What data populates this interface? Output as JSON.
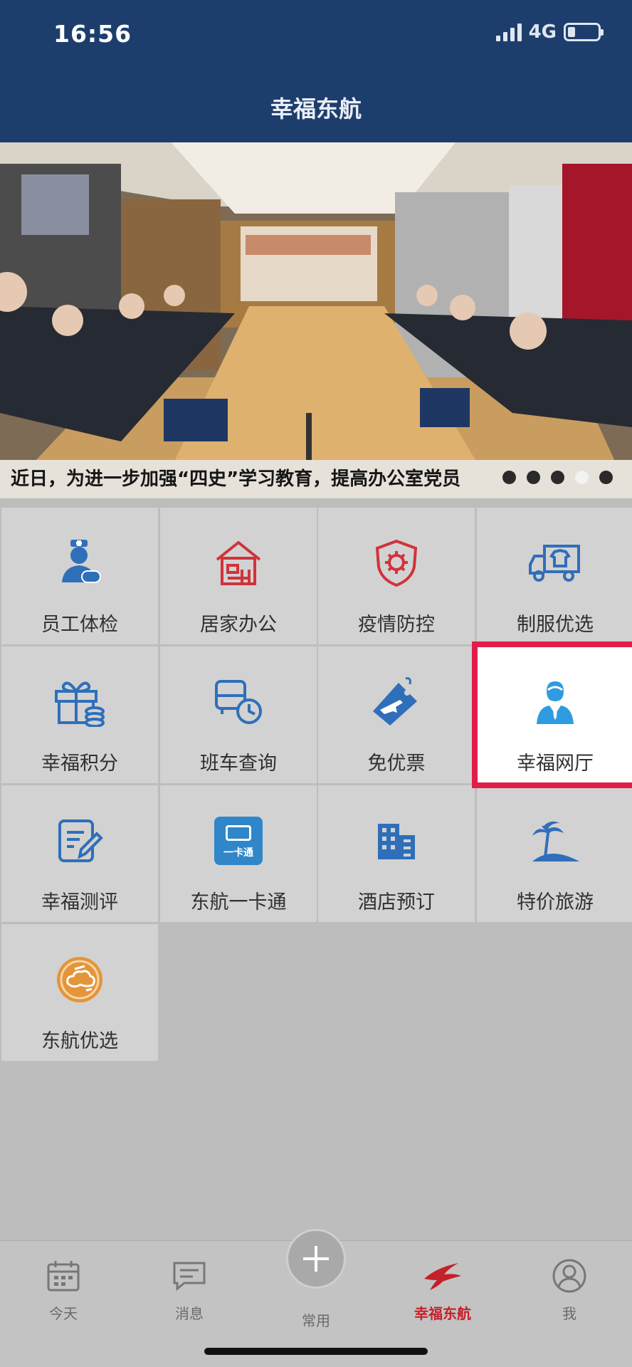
{
  "status_bar": {
    "time": "16:56",
    "network": "4G"
  },
  "header": {
    "title": "幸福东航"
  },
  "banner": {
    "caption": "近日，为进一步加强“四史”学习教育，提高办公室党员",
    "dot_count": 5,
    "active_dot": 3
  },
  "grid": [
    {
      "label": "员工体检",
      "icon": "doctor-icon"
    },
    {
      "label": "居家办公",
      "icon": "home-office-icon"
    },
    {
      "label": "疫情防控",
      "icon": "virus-shield-icon"
    },
    {
      "label": "制服优选",
      "icon": "uniform-truck-icon"
    },
    {
      "label": "幸福积分",
      "icon": "gift-coins-icon"
    },
    {
      "label": "班车查询",
      "icon": "bus-clock-icon"
    },
    {
      "label": "免优票",
      "icon": "ticket-plane-icon"
    },
    {
      "label": "幸福网厅",
      "icon": "person-icon",
      "highlighted": true
    },
    {
      "label": "幸福测评",
      "icon": "edit-note-icon"
    },
    {
      "label": "东航一卡通",
      "icon": "card-icon",
      "card_text": "一卡通"
    },
    {
      "label": "酒店预订",
      "icon": "hotel-building-icon"
    },
    {
      "label": "特价旅游",
      "icon": "palm-island-icon"
    },
    {
      "label": "东航优选",
      "icon": "cloud-seal-icon"
    }
  ],
  "tabbar": [
    {
      "label": "今天",
      "icon": "calendar-icon"
    },
    {
      "label": "消息",
      "icon": "message-icon"
    },
    {
      "label": "常用",
      "icon": "plus-icon"
    },
    {
      "label": "幸福东航",
      "icon": "swallow-logo-icon",
      "active": true
    },
    {
      "label": "我",
      "icon": "user-icon"
    }
  ],
  "colors": {
    "header_bg": "#1d3e6c",
    "highlight": "#e11d48",
    "active_tab": "#c4202a",
    "icon_blue": "#2f6fba",
    "icon_red": "#d2323a"
  }
}
